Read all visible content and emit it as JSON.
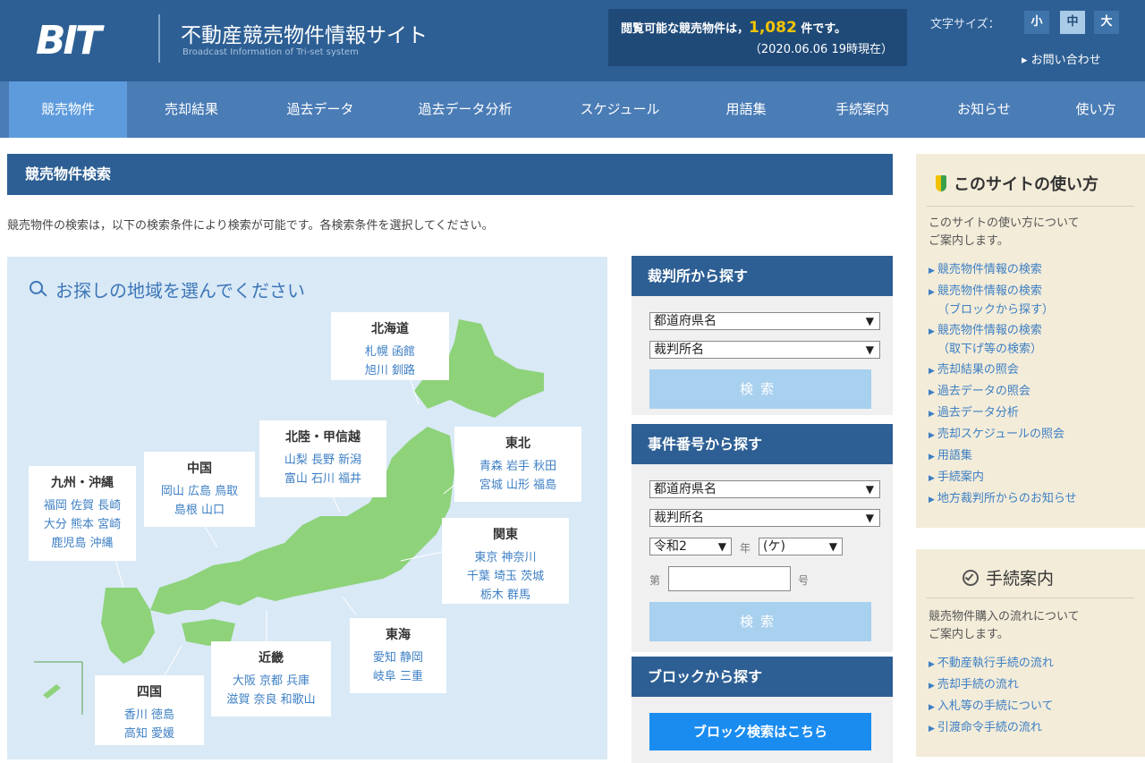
{
  "header": {
    "logo": "BIT",
    "title": "不動産競売物件情報サイト",
    "subtitle": "Broadcast Information of Tri-set system",
    "count_prefix": "閲覧可能な競売物件は，",
    "count_value": "1,082",
    "count_suffix": " 件です。",
    "count_timestamp": "（2020.06.06 19時現在）",
    "font_size_label": "文字サイズ：",
    "font_size_small": "小",
    "font_size_medium": "中",
    "font_size_large": "大",
    "contact_link": "▸ お問い合わせ"
  },
  "nav": {
    "items": [
      {
        "label": "競売物件"
      },
      {
        "label": "売却結果"
      },
      {
        "label": "過去データ"
      },
      {
        "label": "過去データ分析"
      },
      {
        "label": "スケジュール"
      },
      {
        "label": "用語集"
      },
      {
        "label": "手続案内"
      },
      {
        "label": "お知らせ"
      },
      {
        "label": "使い方"
      }
    ]
  },
  "main": {
    "section_title": "競売物件検索",
    "intro": "競売物件の検索は，以下の検索条件により検索が可能です。各検索条件を選択してください。",
    "map_title": "お探しの地域を選んでください",
    "regions": {
      "hokkaido": {
        "name": "北海道",
        "row1": "札幌 函館",
        "row2": "旭川 釧路"
      },
      "tohoku": {
        "name": "東北",
        "row1": "青森 岩手 秋田",
        "row2": "宮城 山形 福島"
      },
      "hokuriku": {
        "name": "北陸・甲信越",
        "row1": "山梨 長野 新潟",
        "row2": "富山 石川 福井"
      },
      "kanto": {
        "name": "関東",
        "row1": "東京 神奈川",
        "row2": "千葉 埼玉 茨城",
        "row3": "栃木 群馬"
      },
      "chugoku": {
        "name": "中国",
        "row1": "岡山 広島 鳥取",
        "row2": "島根 山口"
      },
      "kyushu": {
        "name": "九州・沖縄",
        "row1": "福岡 佐賀 長崎",
        "row2": "大分 熊本 宮崎",
        "row3": "鹿児島 沖縄"
      },
      "tokai": {
        "name": "東海",
        "row1": "愛知 静岡",
        "row2": "岐阜 三重"
      },
      "kinki": {
        "name": "近畿",
        "row1": "大阪 京都 兵庫",
        "row2": "滋賀 奈良 和歌山"
      },
      "shikoku": {
        "name": "四国",
        "row1": "香川 徳島",
        "row2": "高知 愛媛"
      }
    }
  },
  "search": {
    "court": {
      "title": "裁判所から探す",
      "prefecture_select": "都道府県名",
      "court_select": "裁判所名",
      "button": "検索"
    },
    "case": {
      "title": "事件番号から探す",
      "prefecture_select": "都道府県名",
      "court_select": "裁判所名",
      "era_select": "令和2",
      "year_label": "年",
      "type_select": "(ケ)",
      "number_prefix": "第",
      "number_suffix": "号",
      "number_value": "",
      "button": "検索"
    },
    "block": {
      "title": "ブロックから探す",
      "button": "ブロック検索はこちら"
    }
  },
  "sidebar": {
    "howto": {
      "title": "このサイトの使い方",
      "desc1": "このサイトの使い方について",
      "desc2": "ご案内します。",
      "links": [
        {
          "l1": "競売物件情報の検索",
          "l2": ""
        },
        {
          "l1": "競売物件情報の検索",
          "l2": "（ブロックから探す）"
        },
        {
          "l1": "競売物件情報の検索",
          "l2": "（取下げ等の検索）"
        },
        {
          "l1": "売却結果の照会",
          "l2": ""
        },
        {
          "l1": "過去データの照会",
          "l2": ""
        },
        {
          "l1": "過去データ分析",
          "l2": ""
        },
        {
          "l1": "売却スケジュールの照会",
          "l2": ""
        },
        {
          "l1": "用語集",
          "l2": ""
        },
        {
          "l1": "手続案内",
          "l2": ""
        },
        {
          "l1": "地方裁判所からのお知らせ",
          "l2": ""
        }
      ]
    },
    "procedure": {
      "title": "手続案内",
      "desc1": "競売物件購入の流れについて",
      "desc2": "ご案内します。",
      "links": [
        {
          "l1": "不動産執行手続の流れ"
        },
        {
          "l1": "売却手続の流れ"
        },
        {
          "l1": "入札等の手続について"
        },
        {
          "l1": "引渡命令手続の流れ"
        }
      ]
    }
  },
  "colors": {
    "header_bg": "#2d5f94",
    "nav_bg": "#4a7cb6",
    "nav_active": "#5d9bdc",
    "map_bg": "#d9e9f6",
    "land": "#8ed27a",
    "link": "#3d7fc4",
    "accent_count": "#f5c400",
    "primary_button": "#1a8cf0"
  }
}
